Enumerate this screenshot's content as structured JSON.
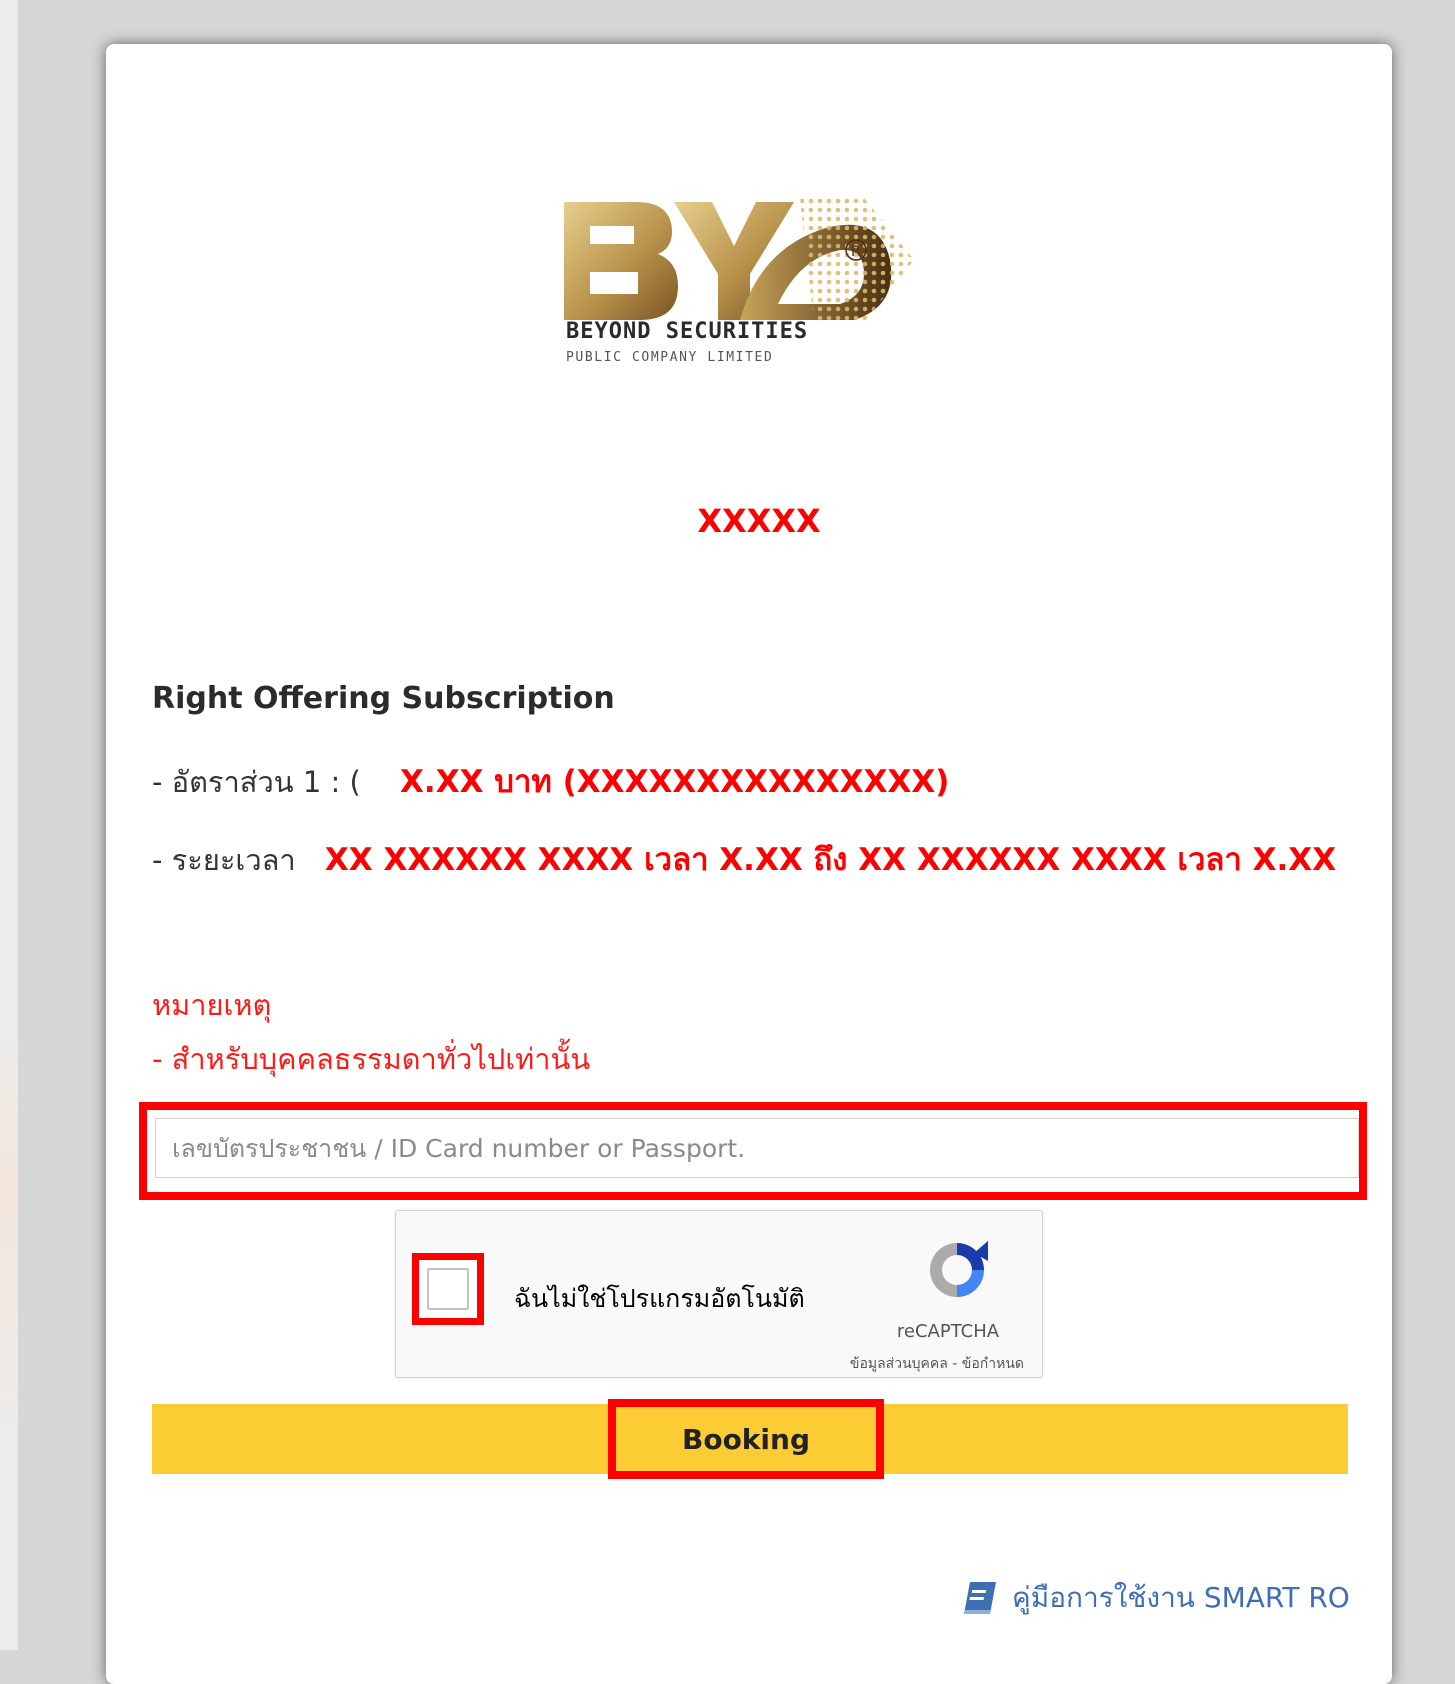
{
  "logo": {
    "brand_line_1": "BEYOND SECURITIES",
    "brand_line_2": "PUBLIC COMPANY LIMITED",
    "gold_color": "#b8924a",
    "dark_gold_color": "#4a2f12"
  },
  "stock_name": "XXXXX",
  "subscription": {
    "title": "Right Offering Subscription",
    "ratio_label": "- อัตราส่วน 1 : (",
    "ratio_value": "X.XX บาท (XXXXXXXXXXXXXXX)",
    "period_label": "- ระยะเวลา",
    "period_value": "XX XXXXXX XXXX เวลา X.XX ถึง XX XXXXXX XXXX เวลา X.XX"
  },
  "note": {
    "title": "หมายเหตุ",
    "line": "- สำหรับบุคคลธรรมดาทั่วไปเท่านั้น"
  },
  "form": {
    "id_placeholder": "เลขบัตรประชาชน / ID Card number or Passport.",
    "id_value": ""
  },
  "captcha": {
    "label": "ฉันไม่ใช่โปรแกรมอัตโนมัติ",
    "brand": "reCAPTCHA",
    "links": "ข้อมูลส่วนบุคคล - ข้อกำหนด"
  },
  "booking": {
    "label": "Booking",
    "bar_color": "#fccc35"
  },
  "manual": {
    "label": "คู่มือการใช้งาน SMART RO",
    "icon": "book-icon"
  },
  "colors": {
    "highlight": "#ff0000",
    "link": "#3f6fb3"
  }
}
